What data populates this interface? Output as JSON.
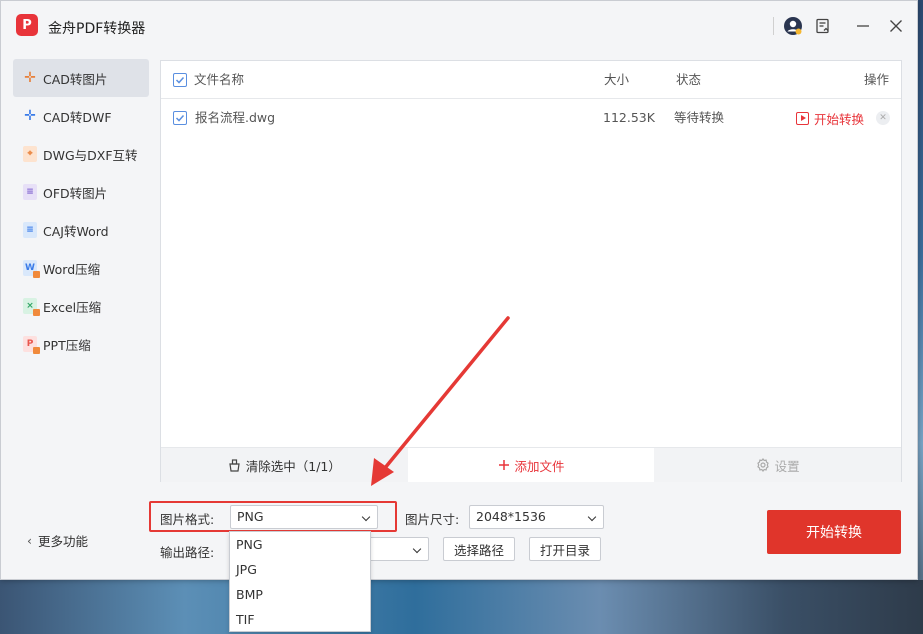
{
  "app": {
    "title": "金舟PDF转换器",
    "logo_letter": "P"
  },
  "sidebar": {
    "items": [
      {
        "label": "CAD转图片",
        "active": true
      },
      {
        "label": "CAD转DWF",
        "active": false
      },
      {
        "label": "DWG与DXF互转",
        "active": false
      },
      {
        "label": "OFD转图片",
        "active": false
      },
      {
        "label": "CAJ转Word",
        "active": false
      },
      {
        "label": "Word压缩",
        "active": false
      },
      {
        "label": "Excel压缩",
        "active": false
      },
      {
        "label": "PPT压缩",
        "active": false
      }
    ],
    "more": "更多功能"
  },
  "table": {
    "headers": {
      "name": "文件名称",
      "size": "大小",
      "status": "状态",
      "action": "操作"
    },
    "rows": [
      {
        "name": "报名流程.dwg",
        "size": "112.53K",
        "status": "等待转换",
        "action": "开始转换",
        "checked": true
      }
    ]
  },
  "panel_footer": {
    "clear": "清除选中（1/1）",
    "add": "添加文件",
    "settings": "设置"
  },
  "options": {
    "format_label": "图片格式:",
    "format_value": "PNG",
    "format_options": [
      "PNG",
      "JPG",
      "BMP",
      "TIF"
    ],
    "size_label": "图片尺寸:",
    "size_value": "2048*1536",
    "output_label": "输出路径:",
    "choose_path": "选择路径",
    "open_dir": "打开目录"
  },
  "start_button": "开始转换",
  "colors": {
    "accent": "#e0352b",
    "checkbox": "#5a8fe0"
  }
}
